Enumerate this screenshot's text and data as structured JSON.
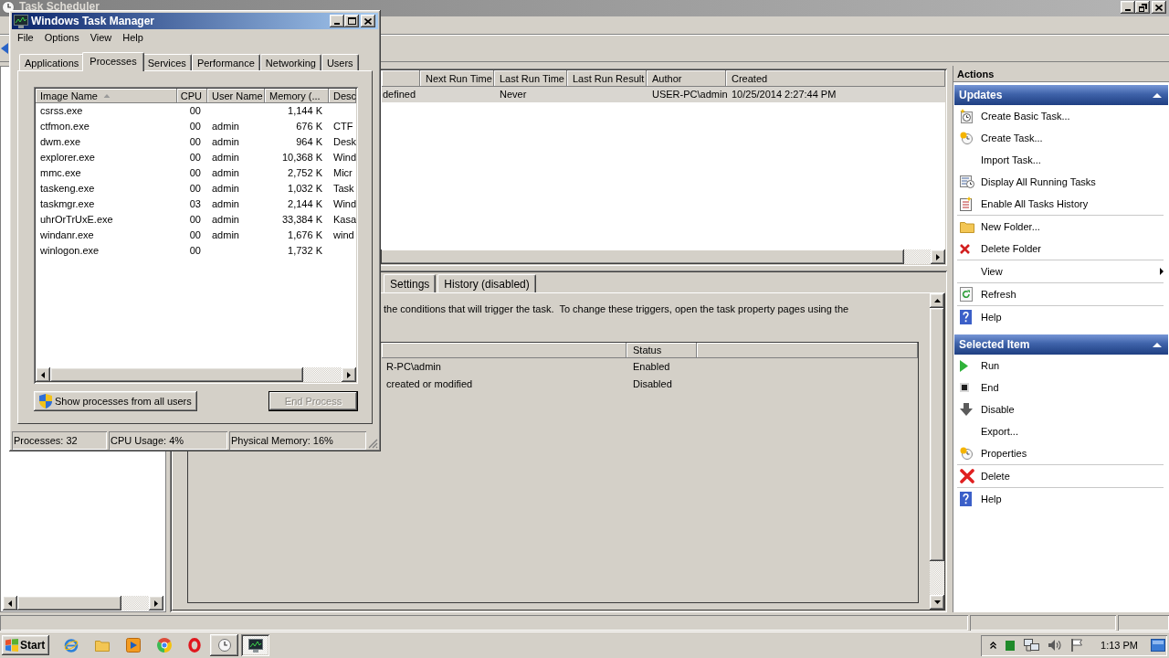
{
  "scheduler": {
    "title": "Task Scheduler",
    "task_list": {
      "columns": [
        "",
        "Next Run Time",
        "Last Run Time",
        "Last Run Result",
        "Author",
        "Created"
      ],
      "rows": [
        {
          "selected": true,
          "cells": [
            "defined",
            "",
            "Never",
            "",
            "USER-PC\\admin",
            "10/25/2014 2:27:44 PM"
          ]
        }
      ]
    },
    "detail": {
      "tabs": [
        {
          "label": "Settings",
          "selected": false
        },
        {
          "label": "History (disabled)",
          "selected": false
        }
      ],
      "description": "the conditions that will trigger the task.  To change these triggers, open the task property pages using the",
      "triggers": {
        "columns": [
          "",
          "Status"
        ],
        "rows": [
          {
            "cells": [
              "R-PC\\admin",
              "Enabled"
            ]
          },
          {
            "cells": [
              "created or modified",
              "Disabled"
            ]
          }
        ]
      }
    },
    "actions": {
      "title": "Actions",
      "sections": [
        {
          "title": "Updates",
          "expanded": true,
          "groups": [
            [
              {
                "label": "Create Basic Task...",
                "kind": "command"
              },
              {
                "label": "Create Task...",
                "kind": "command"
              },
              {
                "label": "Import Task...",
                "kind": "command"
              },
              {
                "label": "Display All Running Tasks",
                "kind": "command"
              },
              {
                "label": "Enable All Tasks History",
                "kind": "command"
              }
            ],
            [
              {
                "label": "New Folder...",
                "kind": "command"
              },
              {
                "label": "Delete Folder",
                "kind": "command"
              }
            ],
            [
              {
                "label": "View",
                "kind": "submenu"
              }
            ],
            [
              {
                "label": "Refresh",
                "kind": "command"
              }
            ],
            [
              {
                "label": "Help",
                "kind": "command"
              }
            ]
          ]
        },
        {
          "title": "Selected Item",
          "expanded": true,
          "groups": [
            [
              {
                "label": "Run",
                "kind": "command"
              },
              {
                "label": "End",
                "kind": "command"
              },
              {
                "label": "Disable",
                "kind": "command"
              },
              {
                "label": "Export...",
                "kind": "command"
              },
              {
                "label": "Properties",
                "kind": "command"
              }
            ],
            [
              {
                "label": "Delete",
                "kind": "command"
              }
            ],
            [
              {
                "label": "Help",
                "kind": "command"
              }
            ]
          ]
        }
      ]
    }
  },
  "taskbar": {
    "start": "Start",
    "window_buttons": [
      {
        "selected": false
      },
      {
        "selected": true
      }
    ],
    "clock": "1:13 PM"
  },
  "task_manager": {
    "title": "Windows Task Manager",
    "menu": [
      "File",
      "Options",
      "View",
      "Help"
    ],
    "tabs": [
      {
        "label": "Applications",
        "selected": false
      },
      {
        "label": "Processes",
        "selected": true
      },
      {
        "label": "Services",
        "selected": false
      },
      {
        "label": "Performance",
        "selected": false
      },
      {
        "label": "Networking",
        "selected": false
      },
      {
        "label": "Users",
        "selected": false
      }
    ],
    "columns": [
      {
        "label": "Image Name",
        "sorted": true
      },
      {
        "label": "CPU",
        "sorted": false
      },
      {
        "label": "User Name",
        "sorted": false
      },
      {
        "label": "Memory (...",
        "sorted": false
      },
      {
        "label": "Desc",
        "sorted": false
      }
    ],
    "rows": [
      {
        "cells": [
          "csrss.exe",
          "00",
          "",
          "1,144 K",
          ""
        ]
      },
      {
        "cells": [
          "ctfmon.exe",
          "00",
          "admin",
          "676 K",
          "CTF"
        ]
      },
      {
        "cells": [
          "dwm.exe",
          "00",
          "admin",
          "964 K",
          "Desk"
        ]
      },
      {
        "cells": [
          "explorer.exe",
          "00",
          "admin",
          "10,368 K",
          "Wind"
        ]
      },
      {
        "cells": [
          "mmc.exe",
          "00",
          "admin",
          "2,752 K",
          "Micr"
        ]
      },
      {
        "cells": [
          "taskeng.exe",
          "00",
          "admin",
          "1,032 K",
          "Task"
        ]
      },
      {
        "cells": [
          "taskmgr.exe",
          "03",
          "admin",
          "2,144 K",
          "Wind"
        ]
      },
      {
        "cells": [
          "uhrOrTrUxE.exe",
          "00",
          "admin",
          "33,384 K",
          "Kasa"
        ]
      },
      {
        "cells": [
          "windanr.exe",
          "00",
          "admin",
          "1,676 K",
          "wind"
        ]
      },
      {
        "cells": [
          "winlogon.exe",
          "00",
          "",
          "1,732 K",
          ""
        ]
      }
    ],
    "show_all_button": "Show processes from all users",
    "end_button": {
      "label": "End Process",
      "disabled": true
    },
    "status": [
      "Processes: 32",
      "CPU Usage: 4%",
      "Physical Memory: 16%"
    ]
  }
}
